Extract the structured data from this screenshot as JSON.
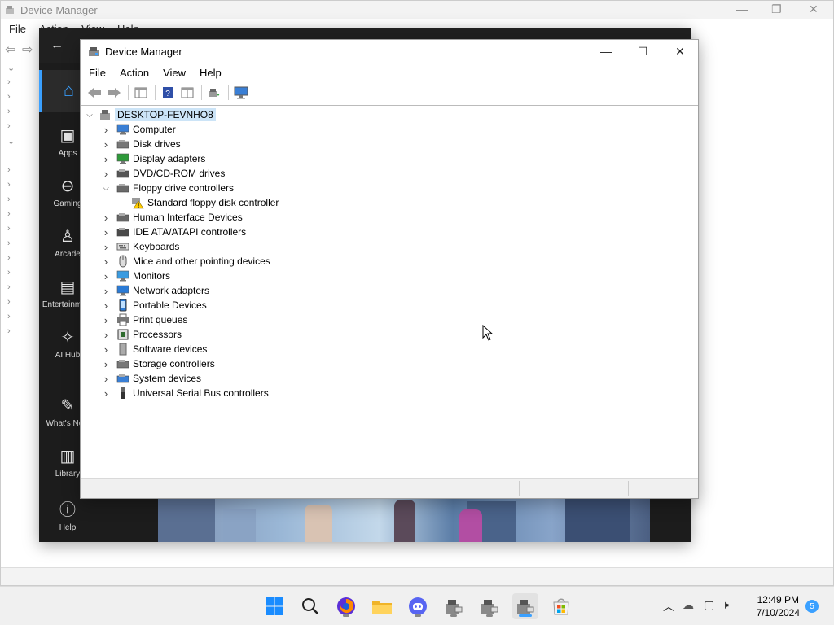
{
  "background_window": {
    "title": "Device Manager",
    "menu": [
      "File",
      "Action",
      "View",
      "Help"
    ]
  },
  "game_app": {
    "nav": [
      {
        "label": "Apps",
        "icon": "apps-icon"
      },
      {
        "label": "Gaming",
        "icon": "gamepad-icon"
      },
      {
        "label": "Arcade",
        "icon": "joystick-icon"
      },
      {
        "label": "Entertainment",
        "icon": "film-icon"
      },
      {
        "label": "AI Hub",
        "icon": "sparkle-icon"
      },
      {
        "label": "What's New",
        "icon": "megaphone-icon"
      },
      {
        "label": "Library",
        "icon": "library-icon"
      },
      {
        "label": "Help",
        "icon": "help-icon"
      }
    ]
  },
  "device_manager": {
    "title": "Device Manager",
    "menu": [
      "File",
      "Action",
      "View",
      "Help"
    ],
    "root": "DESKTOP-FEVNHO8",
    "tree": [
      {
        "label": "Computer",
        "expanded": false,
        "icon": "computer-icon"
      },
      {
        "label": "Disk drives",
        "expanded": false,
        "icon": "disk-drive-icon"
      },
      {
        "label": "Display adapters",
        "expanded": false,
        "icon": "display-adapter-icon"
      },
      {
        "label": "DVD/CD-ROM drives",
        "expanded": false,
        "icon": "dvd-icon"
      },
      {
        "label": "Floppy drive controllers",
        "expanded": true,
        "icon": "floppy-controller-icon"
      },
      {
        "label": "Standard floppy disk controller",
        "child": true,
        "icon": "warning-device-icon"
      },
      {
        "label": "Human Interface Devices",
        "expanded": false,
        "icon": "hid-icon"
      },
      {
        "label": "IDE ATA/ATAPI controllers",
        "expanded": false,
        "icon": "ide-icon"
      },
      {
        "label": "Keyboards",
        "expanded": false,
        "icon": "keyboard-icon"
      },
      {
        "label": "Mice and other pointing devices",
        "expanded": false,
        "icon": "mouse-icon"
      },
      {
        "label": "Monitors",
        "expanded": false,
        "icon": "monitor-icon"
      },
      {
        "label": "Network adapters",
        "expanded": false,
        "icon": "network-icon"
      },
      {
        "label": "Portable Devices",
        "expanded": false,
        "icon": "portable-device-icon"
      },
      {
        "label": "Print queues",
        "expanded": false,
        "icon": "printer-icon"
      },
      {
        "label": "Processors",
        "expanded": false,
        "icon": "processor-icon"
      },
      {
        "label": "Software devices",
        "expanded": false,
        "icon": "software-device-icon"
      },
      {
        "label": "Storage controllers",
        "expanded": false,
        "icon": "storage-controller-icon"
      },
      {
        "label": "System devices",
        "expanded": false,
        "icon": "system-device-icon"
      },
      {
        "label": "Universal Serial Bus controllers",
        "expanded": false,
        "icon": "usb-icon"
      }
    ]
  },
  "taskbar": {
    "apps": [
      "start-icon",
      "search-icon",
      "firefox-icon",
      "file-explorer-icon",
      "discord-icon",
      "device-manager-icon",
      "device-manager-icon",
      "device-manager-icon",
      "store-icon"
    ],
    "time": "12:49 PM",
    "date": "7/10/2024",
    "notifications": "5"
  }
}
